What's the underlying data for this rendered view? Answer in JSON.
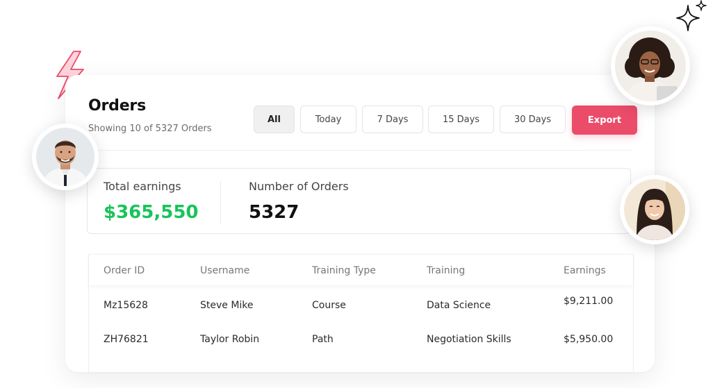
{
  "orders": {
    "title": "Orders",
    "subtitle": "Showing 10 of 5327 Orders",
    "filters": [
      "All",
      "Today",
      "7 Days",
      "15 Days",
      "30 Days"
    ],
    "active_filter": "All",
    "export_label": "Export"
  },
  "stats": {
    "total_earnings": {
      "label": "Total earnings",
      "value": "$365,550"
    },
    "number_of_orders": {
      "label": "Number of Orders",
      "value": "5327"
    }
  },
  "table": {
    "columns": [
      "Order ID",
      "Username",
      "Training Type",
      "Training",
      "Earnings"
    ],
    "rows": [
      [
        "Mz15628",
        "Steve Mike",
        "Course",
        "Data Science",
        "$9,211.00"
      ],
      [
        "ZH76821",
        "Taylor Robin",
        "Path",
        "Negotiation Skills",
        "$5,950.00"
      ]
    ]
  },
  "colors": {
    "accent": "#ea4c6a",
    "earnings_green": "#18c45a",
    "lightning": "#f0607a"
  },
  "decorations": [
    "lightning-icon",
    "sparkle-icon",
    "avatar-man-left",
    "avatar-woman-top-right",
    "avatar-woman-right"
  ]
}
